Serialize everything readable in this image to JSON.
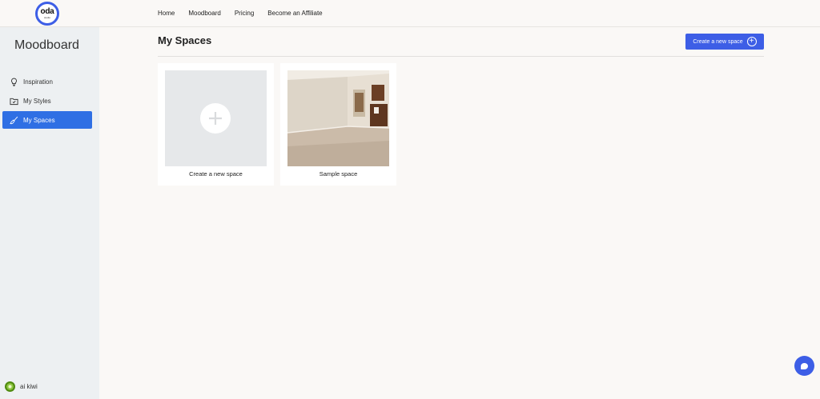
{
  "brand": {
    "logo_text": "oda",
    "logo_subtext": "studio"
  },
  "nav": [
    {
      "label": "Home"
    },
    {
      "label": "Moodboard"
    },
    {
      "label": "Pricing"
    },
    {
      "label": "Become an Affiliate"
    }
  ],
  "sidebar": {
    "title": "Moodboard",
    "items": [
      {
        "label": "Inspiration",
        "icon": "lightbulb-icon"
      },
      {
        "label": "My Styles",
        "icon": "folder-check-icon"
      },
      {
        "label": "My Spaces",
        "icon": "paint-brush-icon",
        "active": true
      }
    ],
    "user": {
      "name": "ai kiwi"
    }
  },
  "main": {
    "title": "My Spaces",
    "create_button": "Create a new space",
    "cards": [
      {
        "caption": "Create a new space",
        "type": "add"
      },
      {
        "caption": "Sample space",
        "type": "image"
      }
    ]
  },
  "colors": {
    "accent": "#3d5ee6",
    "sidebar_active": "#2f6fe4",
    "sidebar_bg": "#edf0f2",
    "page_bg": "#faf8f6"
  }
}
